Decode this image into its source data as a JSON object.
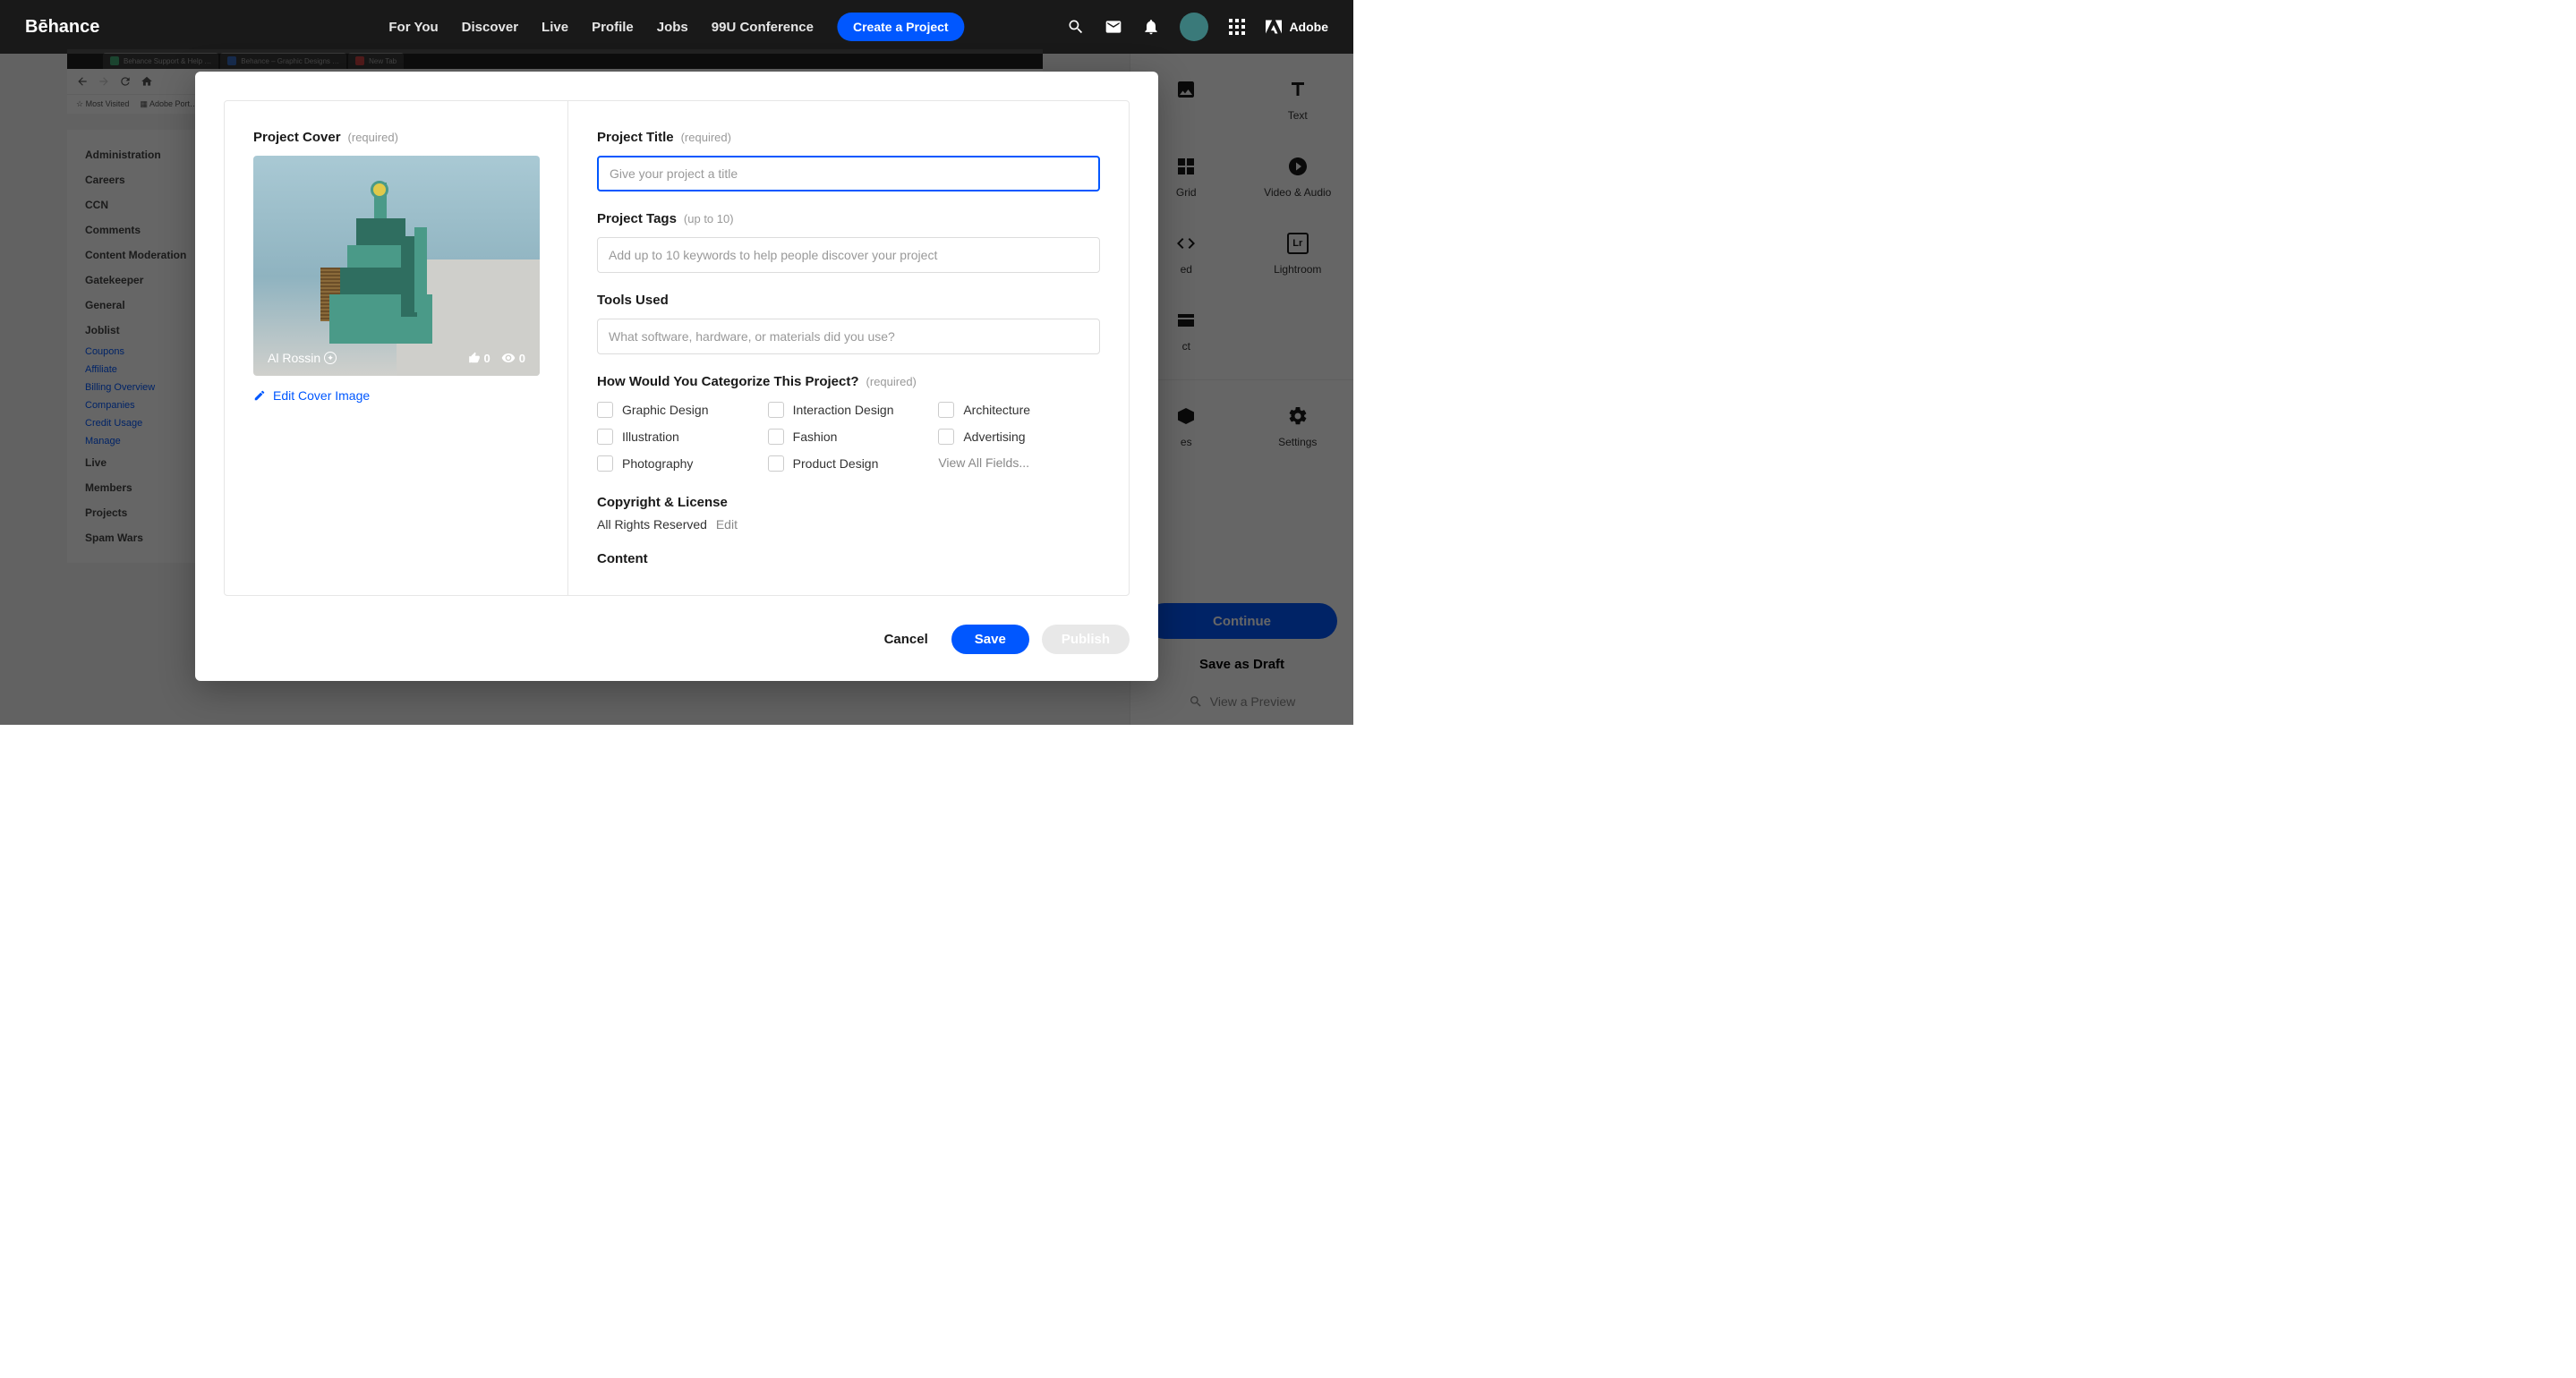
{
  "brand": "Bēhance",
  "nav": {
    "items": [
      "For You",
      "Discover",
      "Live",
      "Profile",
      "Jobs",
      "99U Conference"
    ],
    "create": "Create a Project",
    "adobe": "Adobe"
  },
  "rightPanel": {
    "tools": [
      {
        "icon": "image",
        "label": ""
      },
      {
        "icon": "text",
        "label": "Text"
      },
      {
        "icon": "grid",
        "label": "Grid"
      },
      {
        "icon": "video",
        "label": "Video & Audio"
      },
      {
        "icon": "embed",
        "label": "ed"
      },
      {
        "icon": "lightroom",
        "label": "Lightroom"
      },
      {
        "icon": "project",
        "label": "ct"
      },
      {
        "icon": "",
        "label": ""
      },
      {
        "icon": "styles",
        "label": "es"
      },
      {
        "icon": "settings",
        "label": "Settings"
      }
    ],
    "continue": "Continue",
    "draft": "Save as Draft",
    "preview": "View a Preview"
  },
  "bgSidebar": {
    "items": [
      "Administration",
      "Careers",
      "CCN",
      "Comments",
      "Content Moderation",
      "Gatekeeper",
      "General",
      "Joblist"
    ],
    "subs": [
      "Coupons",
      "Affiliate",
      "Billing Overview",
      "Companies",
      "Credit Usage",
      "Manage"
    ],
    "items2": [
      "Live",
      "Members",
      "Projects",
      "Spam Wars"
    ]
  },
  "bgTabs": [
    "Behance Support & Help …",
    "Behance – Graphic Designs …",
    "New Tab"
  ],
  "bgBookmarks": [
    "Most Visited",
    "Adobe Port…"
  ],
  "modal": {
    "cover": {
      "label": "Project Cover",
      "req": "(required)",
      "author": "Al Rossin",
      "likes": "0",
      "views": "0",
      "editLabel": "Edit Cover Image"
    },
    "title": {
      "label": "Project Title",
      "req": "(required)",
      "placeholder": "Give your project a title"
    },
    "tags": {
      "label": "Project Tags",
      "req": "(up to 10)",
      "placeholder": "Add up to 10 keywords to help people discover your project"
    },
    "tools": {
      "label": "Tools Used",
      "placeholder": "What software, hardware, or materials did you use?"
    },
    "cat": {
      "label": "How Would You Categorize This Project?",
      "req": "(required)",
      "items": [
        "Graphic Design",
        "Interaction Design",
        "Architecture",
        "Illustration",
        "Fashion",
        "Advertising",
        "Photography",
        "Product Design"
      ],
      "viewAll": "View All Fields..."
    },
    "copyright": {
      "label": "Copyright & License",
      "value": "All Rights Reserved",
      "edit": "Edit"
    },
    "content": {
      "label": "Content"
    },
    "footer": {
      "cancel": "Cancel",
      "save": "Save",
      "publish": "Publish"
    }
  }
}
